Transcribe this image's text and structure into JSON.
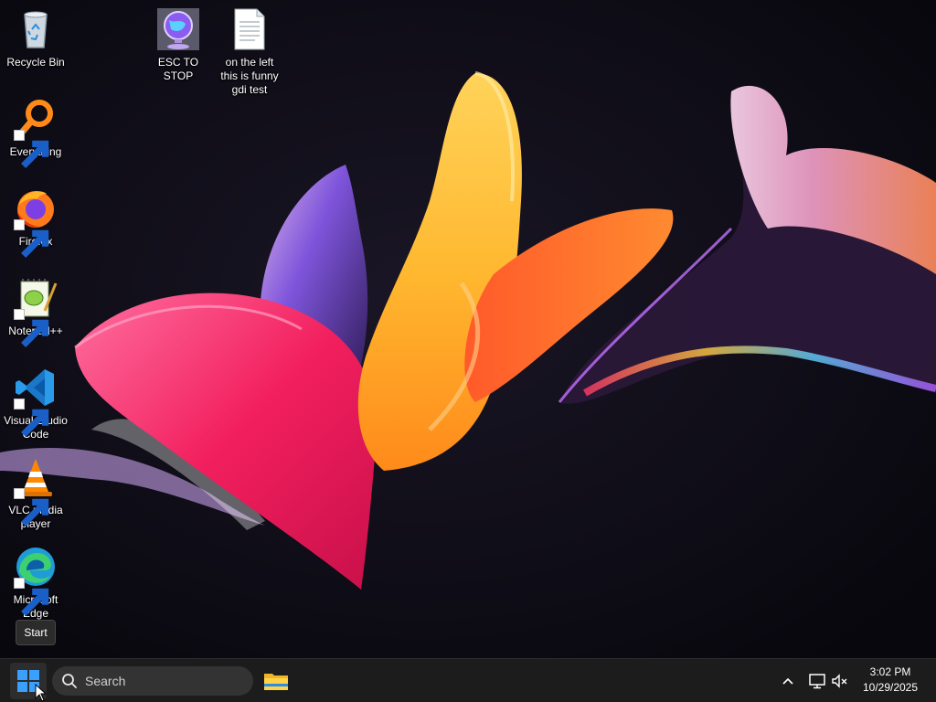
{
  "desktop": {
    "icons": [
      {
        "label": "Recycle Bin",
        "icon": "recycle-bin-icon"
      },
      {
        "label": "Everything",
        "icon": "everything-search-icon"
      },
      {
        "label": "Firefox",
        "icon": "firefox-icon"
      },
      {
        "label": "Notepad++",
        "icon": "notepadplusplus-icon"
      },
      {
        "label": "Visual Studio\nCode",
        "icon": "vscode-icon"
      },
      {
        "label": "VLC media\nplayer",
        "icon": "vlc-icon"
      },
      {
        "label": "Microsoft\nEdge",
        "icon": "edge-icon"
      },
      {
        "label": "ESC TO STOP",
        "icon": "globe-app-icon"
      },
      {
        "label": "on the left\nthis is funny\ngdi test",
        "icon": "text-file-icon"
      }
    ]
  },
  "tooltip": {
    "start": "Start"
  },
  "taskbar": {
    "search_placeholder": "Search",
    "clock_time": "3:02 PM",
    "clock_date": "10/29/2025"
  },
  "colors": {
    "taskbar_bg": "#1c1c1c",
    "accent_blue": "#0078d4",
    "wallpaper_bg": "#0c0a14"
  }
}
